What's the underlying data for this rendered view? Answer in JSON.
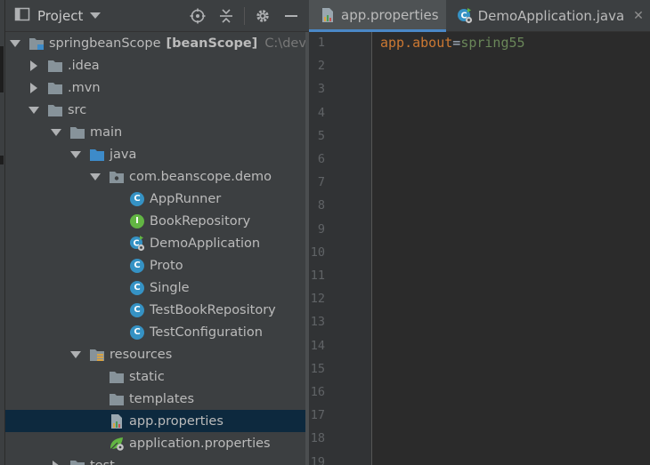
{
  "panel": {
    "title": "Project"
  },
  "tree": [
    {
      "label": "springbeanScope",
      "module": "[beanScope]",
      "path": "C:\\dev\\sp",
      "icon": "module-icon",
      "indent": 0,
      "arrow": "down"
    },
    {
      "label": ".idea",
      "icon": "folder-icon",
      "indent": 1,
      "arrow": "right"
    },
    {
      "label": ".mvn",
      "icon": "folder-icon",
      "indent": 1,
      "arrow": "right"
    },
    {
      "label": "src",
      "icon": "folder-icon",
      "indent": 1,
      "arrow": "down"
    },
    {
      "label": "main",
      "icon": "folder-icon",
      "indent": 2,
      "arrow": "down"
    },
    {
      "label": "java",
      "icon": "source-folder-icon",
      "indent": 3,
      "arrow": "down"
    },
    {
      "label": "com.beanscope.demo",
      "icon": "package-icon",
      "indent": 4,
      "arrow": "down"
    },
    {
      "label": "AppRunner",
      "icon": "class-icon",
      "indent": 5
    },
    {
      "label": "BookRepository",
      "icon": "interface-icon",
      "indent": 5
    },
    {
      "label": "DemoApplication",
      "icon": "spring-boot-class-icon",
      "indent": 5
    },
    {
      "label": "Proto",
      "icon": "class-icon",
      "indent": 5
    },
    {
      "label": "Single",
      "icon": "class-icon",
      "indent": 5
    },
    {
      "label": "TestBookRepository",
      "icon": "class-icon",
      "indent": 5
    },
    {
      "label": "TestConfiguration",
      "icon": "class-icon",
      "indent": 5
    },
    {
      "label": "resources",
      "icon": "resources-folder-icon",
      "indent": 3,
      "arrow": "down"
    },
    {
      "label": "static",
      "icon": "folder-icon",
      "indent": 4
    },
    {
      "label": "templates",
      "icon": "folder-icon",
      "indent": 4
    },
    {
      "label": "app.properties",
      "icon": "properties-file-icon",
      "indent": 4,
      "selected": true
    },
    {
      "label": "application.properties",
      "icon": "spring-properties-icon",
      "indent": 4
    },
    {
      "label": "test",
      "icon": "folder-icon",
      "indent": 2,
      "arrow": "right"
    }
  ],
  "tabs": [
    {
      "label": "app.properties",
      "icon": "properties-file-icon",
      "active": true
    },
    {
      "label": "DemoApplication.java",
      "icon": "spring-boot-class-icon",
      "active": false
    }
  ],
  "editor": {
    "line_numbers": [
      "1",
      "2",
      "3",
      "4",
      "5",
      "6",
      "7",
      "8",
      "9",
      "10",
      "11",
      "12",
      "13",
      "14",
      "15",
      "16",
      "17",
      "18",
      "19"
    ],
    "code": {
      "key": "app.about",
      "sep": "=",
      "value": "spring55"
    }
  },
  "colors": {
    "accent": "#4a88c7",
    "selection": "#0d293e",
    "key": "#cc7832",
    "value": "#6a8759",
    "class_icon": "#3592c4",
    "interface_icon": "#62b543"
  }
}
